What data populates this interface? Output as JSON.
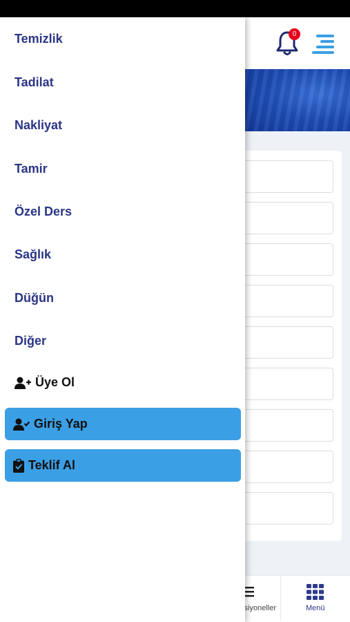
{
  "drawer": {
    "categories": [
      {
        "label": "Temizlik"
      },
      {
        "label": "Tadilat"
      },
      {
        "label": "Nakliyat"
      },
      {
        "label": "Tamir"
      },
      {
        "label": "Özel Ders"
      },
      {
        "label": "Sağlık"
      },
      {
        "label": "Düğün"
      },
      {
        "label": "Diğer"
      }
    ],
    "register_label": "Üye Ol",
    "login_label": "Giriş Yap",
    "quote_label": "Teklif Al"
  },
  "header": {
    "notification_count": "0"
  },
  "bottom_nav": {
    "left_label": "Opsiyoneller",
    "menu_label": "Menü"
  },
  "colors": {
    "accent": "#3b9fe5",
    "brand_text": "#2a3585",
    "badge": "#e4001b"
  }
}
